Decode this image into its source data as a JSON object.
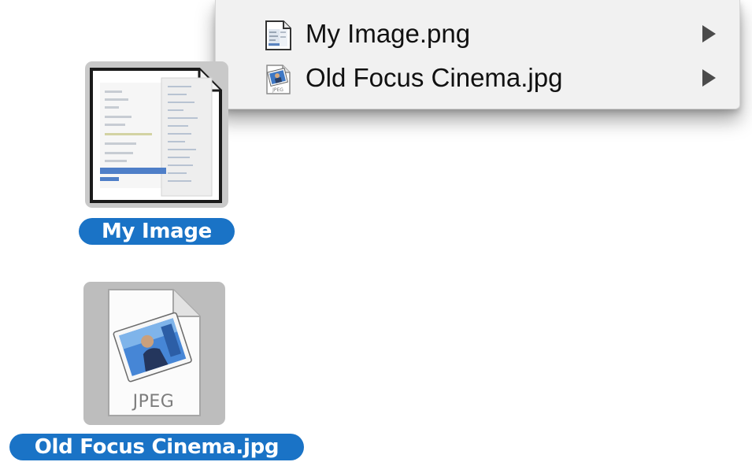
{
  "context_menu": {
    "items": [
      {
        "label": "My Image.png",
        "icon": "png-document-icon",
        "has_submenu": true
      },
      {
        "label": "Old Focus Cinema.jpg",
        "icon": "jpeg-preview-icon",
        "has_submenu": true
      }
    ]
  },
  "desktop": {
    "icons": [
      {
        "label": "My Image",
        "icon": "screenshot-thumbnail-icon",
        "selected": true
      },
      {
        "label": "Old Focus Cinema.jpg",
        "icon": "jpeg-document-icon",
        "file_type_text": "JPEG",
        "selected": true
      }
    ]
  },
  "colors": {
    "selection_blue": "#1a73c6",
    "menu_background": "#f1f1f1",
    "icon_highlight": "#c9c9c9"
  }
}
